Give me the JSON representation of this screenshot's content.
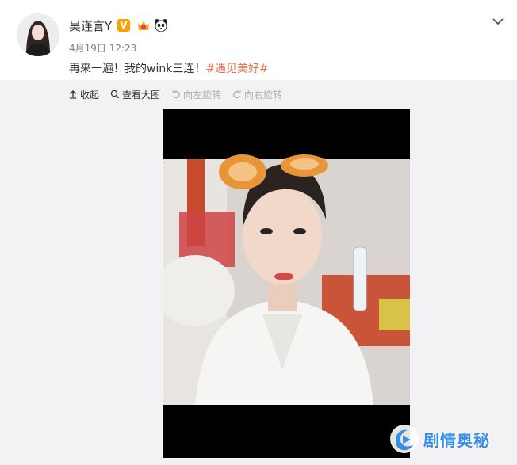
{
  "post": {
    "username": "吴谨言Y",
    "verified_label": "V",
    "timestamp": "4月19日 12:23",
    "text": "再来一遍！我的wink三连！",
    "hashtag": "#遇见美好#"
  },
  "toolbar": {
    "collapse_label": "收起",
    "view_large_label": "查看大图",
    "rotate_left_label": "向左旋转",
    "rotate_right_label": "向右旋转"
  },
  "watermark": {
    "text": "剧情奥秘"
  },
  "colors": {
    "hashtag": "#eb7350",
    "verified": "#f5a200",
    "media_background": "#f2f2f5",
    "watermark": "#3a8ee6"
  },
  "icons": {
    "collapse": "arrow-up-icon",
    "view_large": "search-icon",
    "rotate_left": "rotate-left-icon",
    "rotate_right": "rotate-right-icon",
    "more": "chevron-down-icon"
  }
}
